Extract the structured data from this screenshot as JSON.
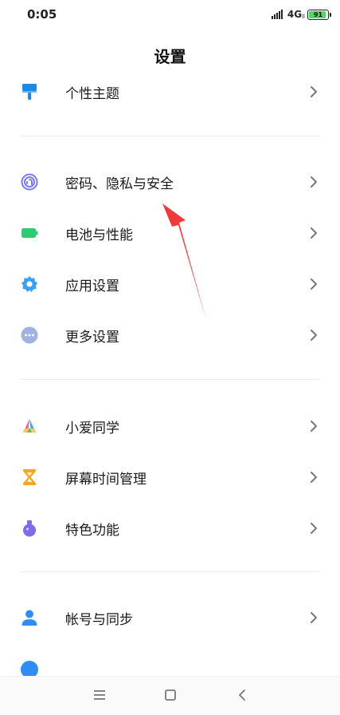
{
  "status_bar": {
    "time": "0:05",
    "network": "4G",
    "network_sub": "ll",
    "battery": "91",
    "battery_level": 0.91
  },
  "header": {
    "title": "设置"
  },
  "groups": [
    {
      "items": [
        {
          "label": "个性主题",
          "icon": "paint-brush-icon"
        }
      ]
    },
    {
      "items": [
        {
          "label": "密码、隐私与安全",
          "icon": "fingerprint-icon"
        },
        {
          "label": "电池与性能",
          "icon": "battery-icon"
        },
        {
          "label": "应用设置",
          "icon": "gear-icon"
        },
        {
          "label": "更多设置",
          "icon": "more-dots-icon"
        }
      ]
    },
    {
      "items": [
        {
          "label": "小爱同学",
          "icon": "xiaoai-icon"
        },
        {
          "label": "屏幕时间管理",
          "icon": "hourglass-icon"
        },
        {
          "label": "特色功能",
          "icon": "flask-icon"
        }
      ]
    },
    {
      "items": [
        {
          "label": "帐号与同步",
          "icon": "person-icon"
        }
      ]
    }
  ],
  "colors": {
    "theme_blue": "#1e88e5",
    "fingerprint_purple": "#7b79e8",
    "battery_green": "#2ecc71",
    "gear_blue": "#3aa0f5",
    "more_gray": "#9fb3e0",
    "hourglass_orange": "#f6a623",
    "flask_purple": "#7b6ee8",
    "account_blue": "#2f8ef5",
    "annotation_red": "#f03a3a"
  }
}
